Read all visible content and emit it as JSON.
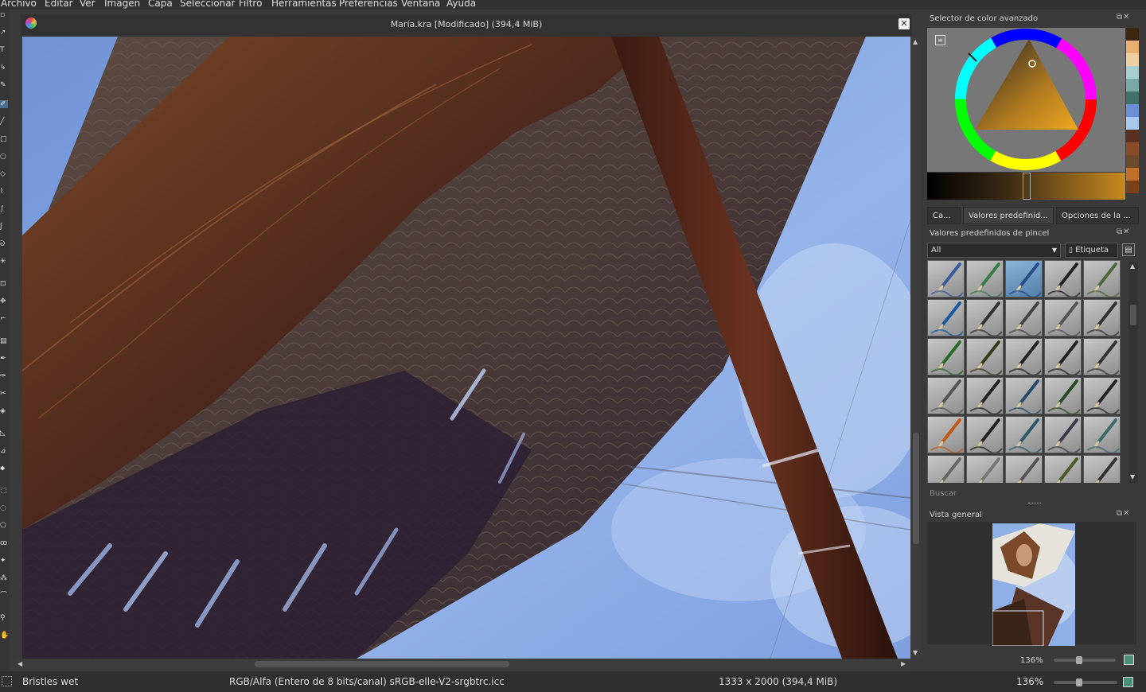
{
  "menu": [
    "Archivo",
    "Editar",
    "Ver",
    "Imagen",
    "Capa",
    "Seleccionar",
    "Filtro",
    "Herramientas",
    "Preferencias",
    "Ventana",
    "Ayuda"
  ],
  "document": {
    "title": "María.kra [Modificado]  (394,4 MiB)",
    "close": "✕"
  },
  "color_selector": {
    "title": "Selector de color avanzado"
  },
  "dock_tabs": [
    "Ca...",
    "Valores predefinid...",
    "Opciones de la ..."
  ],
  "presets": {
    "title": "Valores predefinidos de pincel",
    "filter": "All",
    "tag_button": "Etiqueta",
    "search_placeholder": "Buscar"
  },
  "overview": {
    "title": "Vista general",
    "zoom": "136%"
  },
  "status": {
    "brush": "Bristles wet",
    "color_space": "RGB/Alfa (Entero de 8 bits/canal)  sRGB-elle-V2-srgbtrc.icc",
    "dimensions": "1333 x 2000 (394,4 MiB)",
    "zoom": "136%"
  },
  "swatches": [
    "#3a2612",
    "#e8b070",
    "#f0d0a0",
    "#a8d0d0",
    "#7aa8a8",
    "#40706a",
    "#6a90d8",
    "#a8c8f0",
    "#5a3020",
    "#8a4a28",
    "#6a4a2a",
    "#c0702a",
    "#7a4018"
  ],
  "icons": {
    "close": "close-icon",
    "float": "float-icon",
    "menu": "menu-icon"
  }
}
